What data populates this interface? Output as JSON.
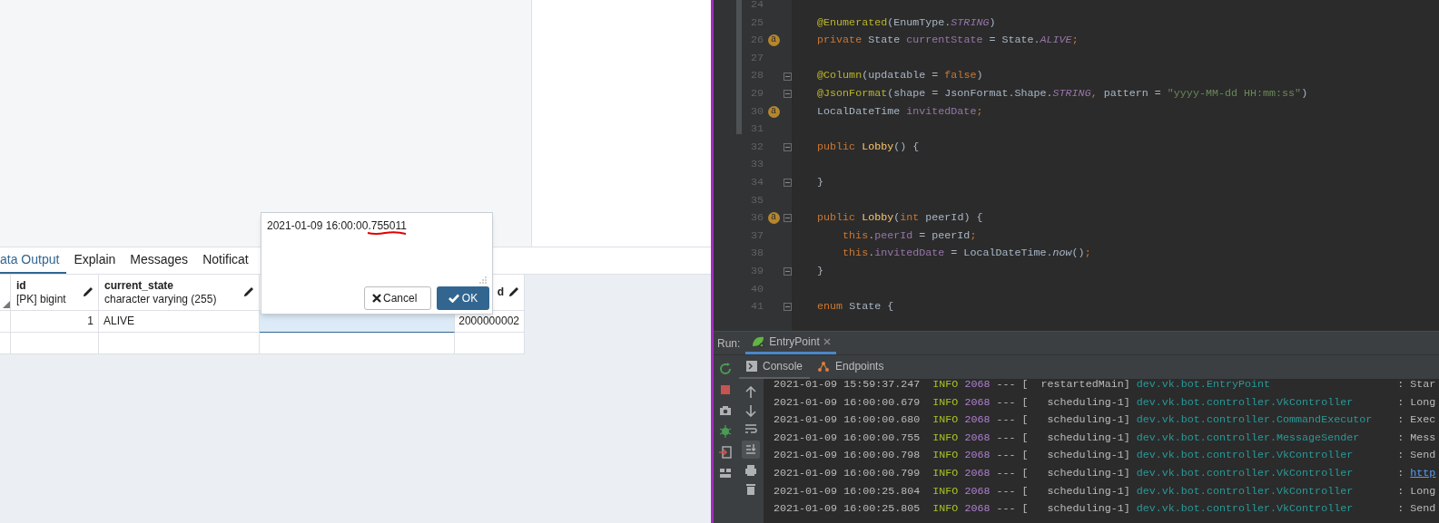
{
  "query_tool": {
    "tabs": [
      {
        "label": "ata Output",
        "selected": true
      },
      {
        "label": "Explain",
        "selected": false
      },
      {
        "label": "Messages",
        "selected": false
      },
      {
        "label": "Notificat",
        "selected": false
      }
    ],
    "grid": {
      "columns": [
        {
          "name": "id",
          "type": "[PK] bigint"
        },
        {
          "name": "current_state",
          "type": "character varying (255)"
        },
        {
          "name": "d"
        }
      ],
      "rows": [
        {
          "id": "1",
          "current_state": "ALIVE",
          "column_4": "2000000002",
          "editing": true
        }
      ]
    },
    "cell_editor": {
      "value": "2021-01-09 16:00:00.755011",
      "buttons": [
        {
          "label": "Cancel",
          "kind": "cancel"
        },
        {
          "label": "OK",
          "kind": "ok"
        }
      ]
    }
  },
  "ide": {
    "code_lines": [
      {
        "n": "24"
      },
      {
        "n": "25",
        "tokens": [
          {
            "text": "@Enumerated",
            "kind": "ann"
          },
          {
            "text": "(EnumType.",
            "kind": "p"
          },
          {
            "text": "STRING",
            "kind": "const"
          },
          {
            "text": ")",
            "kind": "p"
          }
        ]
      },
      {
        "n": "26",
        "marker": "a",
        "tokens": [
          {
            "text": "private",
            "kind": "kw"
          },
          {
            "text": " State ",
            "kind": "p"
          },
          {
            "text": "currentState",
            "kind": "field"
          },
          {
            "text": " = State.",
            "kind": "p"
          },
          {
            "text": "ALIVE",
            "kind": "const"
          },
          {
            "text": ";",
            "kind": "kw"
          }
        ]
      },
      {
        "n": "27"
      },
      {
        "n": "28",
        "fold": true,
        "tokens": [
          {
            "text": "@Column",
            "kind": "ann"
          },
          {
            "text": "(updatable = ",
            "kind": "p"
          },
          {
            "text": "false",
            "kind": "kw"
          },
          {
            "text": ")",
            "kind": "p"
          }
        ]
      },
      {
        "n": "29",
        "fold": true,
        "tokens": [
          {
            "text": "@JsonFormat",
            "kind": "ann"
          },
          {
            "text": "(shape = JsonFormat.Shape.",
            "kind": "p"
          },
          {
            "text": "STRING",
            "kind": "const"
          },
          {
            "text": ", ",
            "kind": "kw"
          },
          {
            "text": "pattern = ",
            "kind": "p"
          },
          {
            "text": "\"yyyy-MM-dd HH:mm:ss\"",
            "kind": "str"
          },
          {
            "text": ")",
            "kind": "p"
          }
        ]
      },
      {
        "n": "30",
        "marker": "a",
        "tokens": [
          {
            "text": "LocalDateTime ",
            "kind": "p"
          },
          {
            "text": "invitedDate",
            "kind": "field"
          },
          {
            "text": ";",
            "kind": "kw"
          }
        ]
      },
      {
        "n": "31"
      },
      {
        "n": "32",
        "fold": true,
        "tokens": [
          {
            "text": "public ",
            "kind": "kw"
          },
          {
            "text": "Lobby",
            "kind": "method"
          },
          {
            "text": "() {",
            "kind": "p"
          }
        ]
      },
      {
        "n": "33"
      },
      {
        "n": "34",
        "fold": true,
        "tokens": [
          {
            "text": "}",
            "kind": "p"
          }
        ]
      },
      {
        "n": "35"
      },
      {
        "n": "36",
        "marker": "a",
        "fold": true,
        "tokens": [
          {
            "text": "public ",
            "kind": "kw"
          },
          {
            "text": "Lobby",
            "kind": "method"
          },
          {
            "text": "(",
            "kind": "p"
          },
          {
            "text": "int",
            "kind": "kw"
          },
          {
            "text": " peerId) {",
            "kind": "p"
          }
        ]
      },
      {
        "n": "37",
        "in_block": true,
        "tokens": [
          {
            "text": "this",
            "kind": "kw"
          },
          {
            "text": ".",
            "kind": "p"
          },
          {
            "text": "peerId",
            "kind": "field"
          },
          {
            "text": " = peerId",
            "kind": "p"
          },
          {
            "text": ";",
            "kind": "kw"
          }
        ]
      },
      {
        "n": "38",
        "in_block": true,
        "tokens": [
          {
            "text": "this",
            "kind": "kw"
          },
          {
            "text": ".",
            "kind": "p"
          },
          {
            "text": "invitedDate",
            "kind": "field"
          },
          {
            "text": " = LocalDateTime.",
            "kind": "p"
          },
          {
            "text": "now",
            "kind": "italic"
          },
          {
            "text": "()",
            "kind": "p"
          },
          {
            "text": ";",
            "kind": "kw"
          }
        ]
      },
      {
        "n": "39",
        "fold": true,
        "tokens": [
          {
            "text": "}",
            "kind": "p"
          }
        ]
      },
      {
        "n": "40"
      },
      {
        "n": "41",
        "fold": true,
        "tokens": [
          {
            "text": "enum ",
            "kind": "kw"
          },
          {
            "text": "State {",
            "kind": "p"
          }
        ]
      }
    ],
    "run_panel": {
      "label": "Run:",
      "config_tab": "EntryPoint",
      "tabs": [
        {
          "label": "Console",
          "selected": true
        },
        {
          "label": "Endpoints",
          "selected": false
        }
      ],
      "log_lines": [
        {
          "time": "2021-01-09 15:59:37.247",
          "level": "INFO",
          "pid": "2068",
          "dashes": "---",
          "thread": "[  restartedMain]",
          "logger": "dev.vk.bot.EntryPoint",
          "separator": ":",
          "message": "Star",
          "link": false
        },
        {
          "time": "2021-01-09 16:00:00.679",
          "level": "INFO",
          "pid": "2068",
          "dashes": "---",
          "thread": "[   scheduling-1]",
          "logger": "dev.vk.bot.controller.VkController",
          "separator": ":",
          "message": "Long",
          "link": false
        },
        {
          "time": "2021-01-09 16:00:00.680",
          "level": "INFO",
          "pid": "2068",
          "dashes": "---",
          "thread": "[   scheduling-1]",
          "logger": "dev.vk.bot.controller.CommandExecutor",
          "separator": ":",
          "message": "Exec",
          "link": false
        },
        {
          "time": "2021-01-09 16:00:00.755",
          "level": "INFO",
          "pid": "2068",
          "dashes": "---",
          "thread": "[   scheduling-1]",
          "logger": "dev.vk.bot.controller.MessageSender",
          "separator": ":",
          "message": "Mess",
          "link": false
        },
        {
          "time": "2021-01-09 16:00:00.798",
          "level": "INFO",
          "pid": "2068",
          "dashes": "---",
          "thread": "[   scheduling-1]",
          "logger": "dev.vk.bot.controller.VkController",
          "separator": ":",
          "message": "Send",
          "link": false
        },
        {
          "time": "2021-01-09 16:00:00.799",
          "level": "INFO",
          "pid": "2068",
          "dashes": "---",
          "thread": "[   scheduling-1]",
          "logger": "dev.vk.bot.controller.VkController",
          "separator": ":",
          "message": "http",
          "link": true
        },
        {
          "time": "2021-01-09 16:00:25.804",
          "level": "INFO",
          "pid": "2068",
          "dashes": "---",
          "thread": "[   scheduling-1]",
          "logger": "dev.vk.bot.controller.VkController",
          "separator": ":",
          "message": "Long",
          "link": false
        },
        {
          "time": "2021-01-09 16:00:25.805",
          "level": "INFO",
          "pid": "2068",
          "dashes": "---",
          "thread": "[   scheduling-1]",
          "logger": "dev.vk.bot.controller.VkController",
          "separator": ":",
          "message": "Send",
          "link": false
        }
      ]
    }
  }
}
